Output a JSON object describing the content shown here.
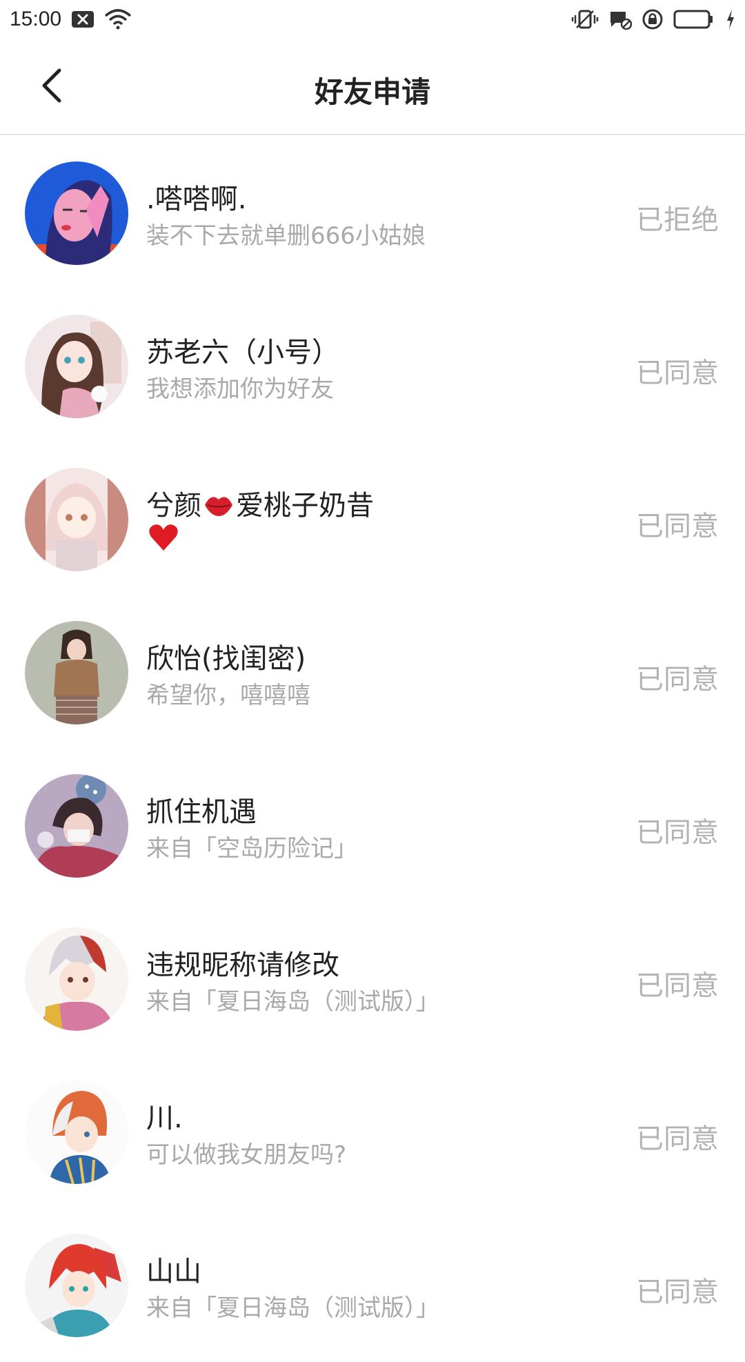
{
  "statusbar": {
    "time": "15:00"
  },
  "header": {
    "title": "好友申请"
  },
  "requests": [
    {
      "name": ".嗒嗒啊.",
      "message": "装不下去就单删666小姑娘",
      "status": "已拒绝"
    },
    {
      "name": "苏老六（小号）",
      "message": "我想添加你为好友",
      "status": "已同意"
    },
    {
      "name_before": "兮颜",
      "name_after": "爱桃子奶昔",
      "message": "",
      "status": "已同意"
    },
    {
      "name": "欣怡(找闺密)",
      "message": "希望你，嘻嘻嘻",
      "status": "已同意"
    },
    {
      "name": "抓住机遇",
      "message": "来自「空岛历险记」",
      "status": "已同意"
    },
    {
      "name": "违规昵称请修改",
      "message": "来自「夏日海岛（测试版）」",
      "status": "已同意"
    },
    {
      "name": "川.",
      "message": "可以做我女朋友吗?",
      "status": "已同意"
    },
    {
      "name": "山山",
      "message": "来自「夏日海岛（测试版）」",
      "status": "已同意"
    }
  ],
  "colors": {
    "status_text": "#b3b3b3",
    "subtext": "#a9a9a9",
    "divider": "#e6e6e6"
  },
  "icons": [
    "back-arrow-icon",
    "close-box-icon",
    "wifi-icon",
    "vibrate-icon",
    "message-icon",
    "lock-rotation-icon",
    "battery-icon",
    "charging-icon",
    "lips-emoji-icon",
    "heart-emoji-icon"
  ]
}
